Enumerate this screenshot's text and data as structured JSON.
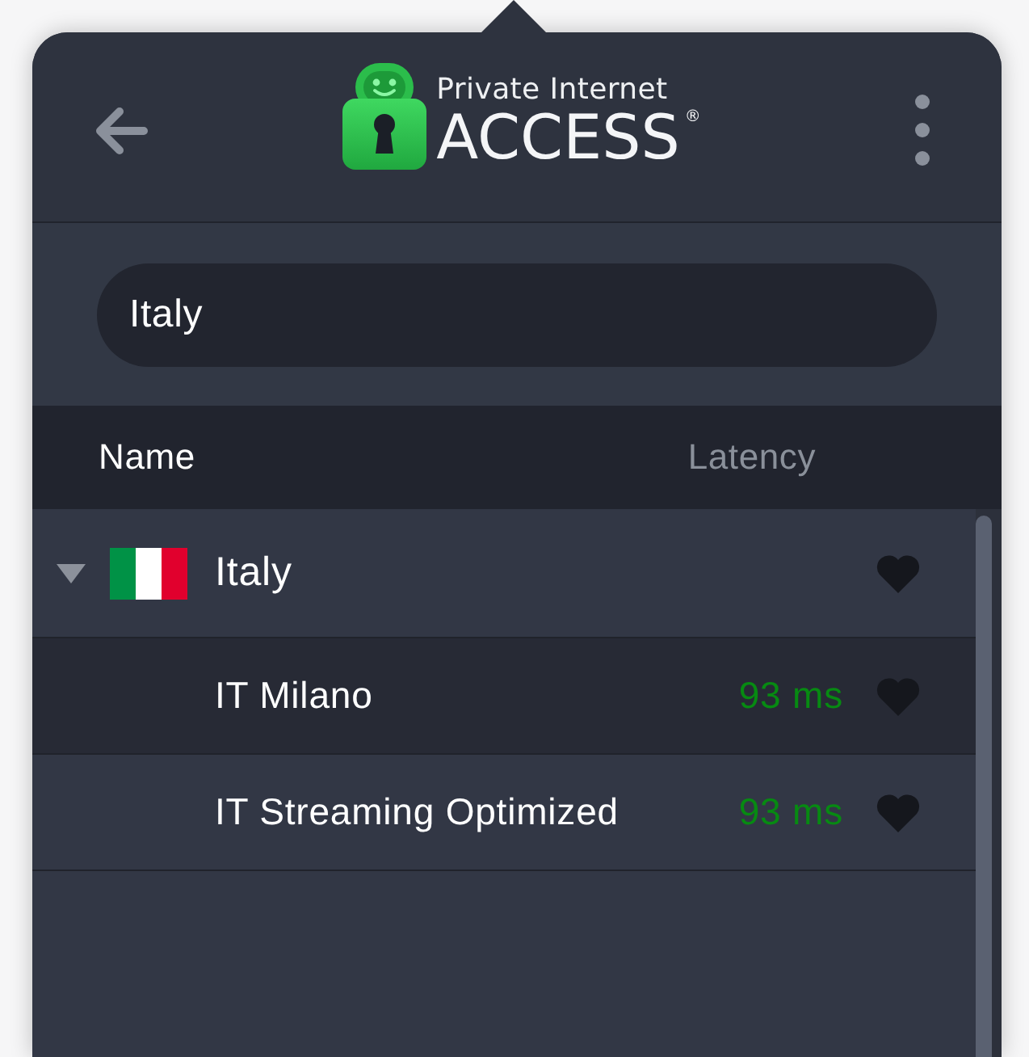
{
  "header": {
    "logo": {
      "line_1": "Private Internet",
      "line_2": "ACCESS$^{®}$"
    }
  },
  "search": {
    "value": "Italy"
  },
  "columns": [
    "Name",
    "Latency"
  ],
  "regions": [
    {
      "name": "Italy",
      "expanded": true,
      "selected": false,
      "favorite": false,
      "children": [
        {
          "name": "IT Milano",
          "latency": "93 ms",
          "selected": true,
          "favorite": false
        },
        {
          "name": "IT Streaming Optimized",
          "latency": "93 ms",
          "selected": false,
          "favorite": false
        }
      ]
    }
  ]
}
